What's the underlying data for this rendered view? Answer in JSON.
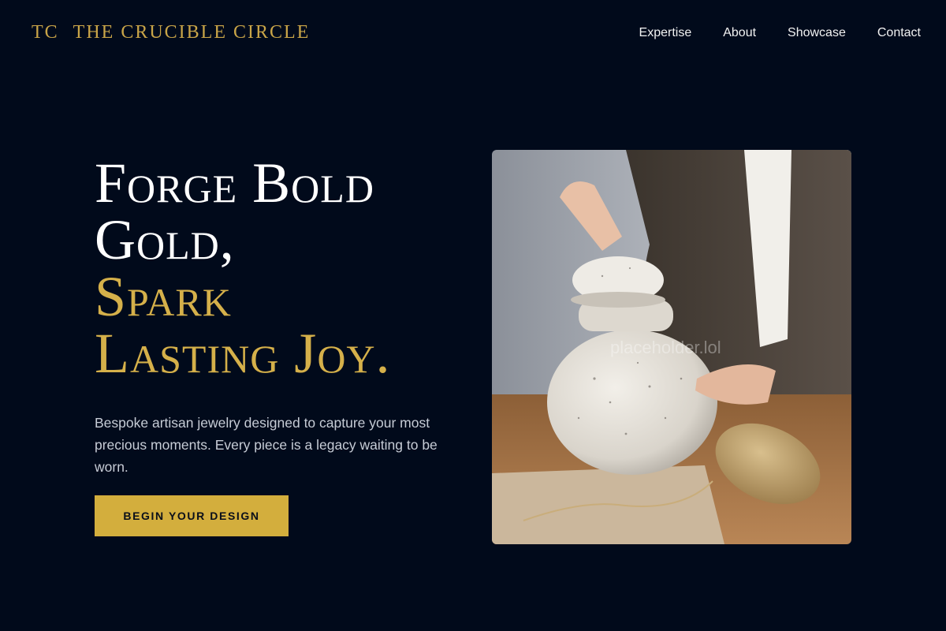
{
  "brand": {
    "monogram": "TC",
    "name": "THE CRUCIBLE CIRCLE",
    "color": "#c9a548"
  },
  "nav": {
    "items": [
      {
        "label": "Expertise"
      },
      {
        "label": "About"
      },
      {
        "label": "Showcase"
      },
      {
        "label": "Contact"
      }
    ]
  },
  "hero": {
    "headline_line1": "Forge Bold",
    "headline_line2": "Gold,",
    "headline_line3": "Spark",
    "headline_line4": "Lasting Joy.",
    "subtitle": "Bespoke artisan jewelry designed to capture your most precious moments. Every piece is a legacy waiting to be worn.",
    "cta_label": "BEGIN YOUR DESIGN",
    "image_watermark": "placeholder.lol"
  },
  "colors": {
    "background": "#010a1b",
    "accent": "#d3ae3d",
    "headline_gold": "#d5b04a"
  }
}
